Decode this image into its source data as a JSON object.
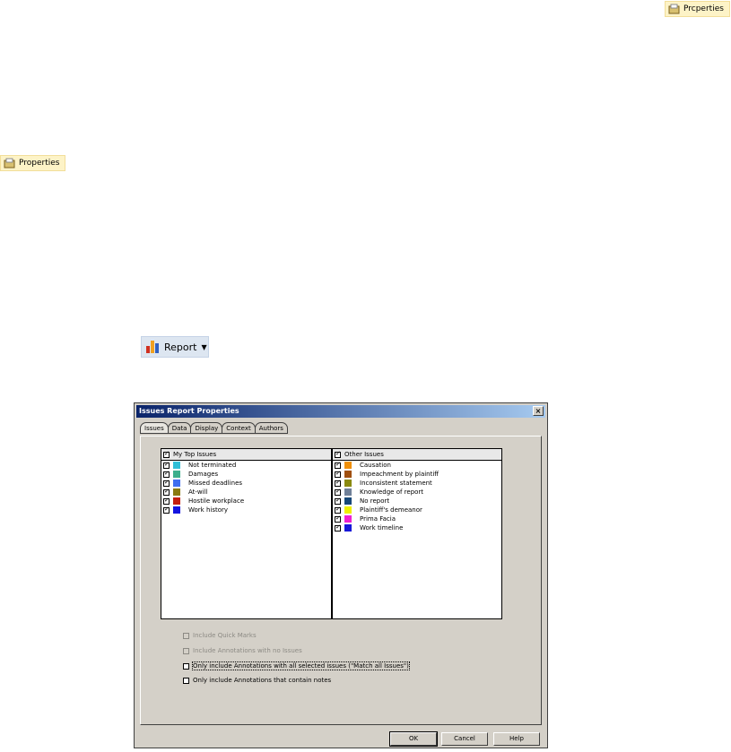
{
  "toolbar_buttons": {
    "properties_top_right": "Prcperties",
    "properties_left": "Properties",
    "report": "Report"
  },
  "dialog": {
    "title": "Issues Report Properties",
    "tabs": [
      "Issues",
      "Data",
      "Display",
      "Context",
      "Authors"
    ],
    "left_list": {
      "header": "My Top Issues",
      "items": [
        {
          "label": "Not terminated",
          "color": "#2fbfd8"
        },
        {
          "label": "Damages",
          "color": "#3caf8c"
        },
        {
          "label": "Missed deadlines",
          "color": "#3f6ef0"
        },
        {
          "label": "At-will",
          "color": "#8a7a10"
        },
        {
          "label": "Hostile workplace",
          "color": "#c41e10"
        },
        {
          "label": "Work history",
          "color": "#1414e0"
        }
      ]
    },
    "right_list": {
      "header": "Other Issues",
      "items": [
        {
          "label": "Causation",
          "color": "#f0900a"
        },
        {
          "label": "Impeachment by plaintiff",
          "color": "#a05010"
        },
        {
          "label": "Inconsistent statement",
          "color": "#8a8a10"
        },
        {
          "label": "Knowledge of report",
          "color": "#708098"
        },
        {
          "label": "No report",
          "color": "#184878"
        },
        {
          "label": "Plaintiff's demeanor",
          "color": "#f0f000"
        },
        {
          "label": "Prima Facia",
          "color": "#f020d0"
        },
        {
          "label": "Work timeline",
          "color": "#1818d8"
        }
      ]
    },
    "options": [
      {
        "label": "Include Quick Marks",
        "checked": false,
        "disabled": true
      },
      {
        "label": "Include Annotations with no Issues",
        "checked": false,
        "disabled": true
      },
      {
        "label": "Only include Annotations with all selected issues (\"Match all Issues\")",
        "checked": false,
        "disabled": false
      },
      {
        "label": "Only include Annotations that contain notes",
        "checked": false,
        "disabled": false
      }
    ],
    "buttons": {
      "ok": "OK",
      "cancel": "Cancel",
      "help": "Help"
    },
    "close": "×"
  }
}
